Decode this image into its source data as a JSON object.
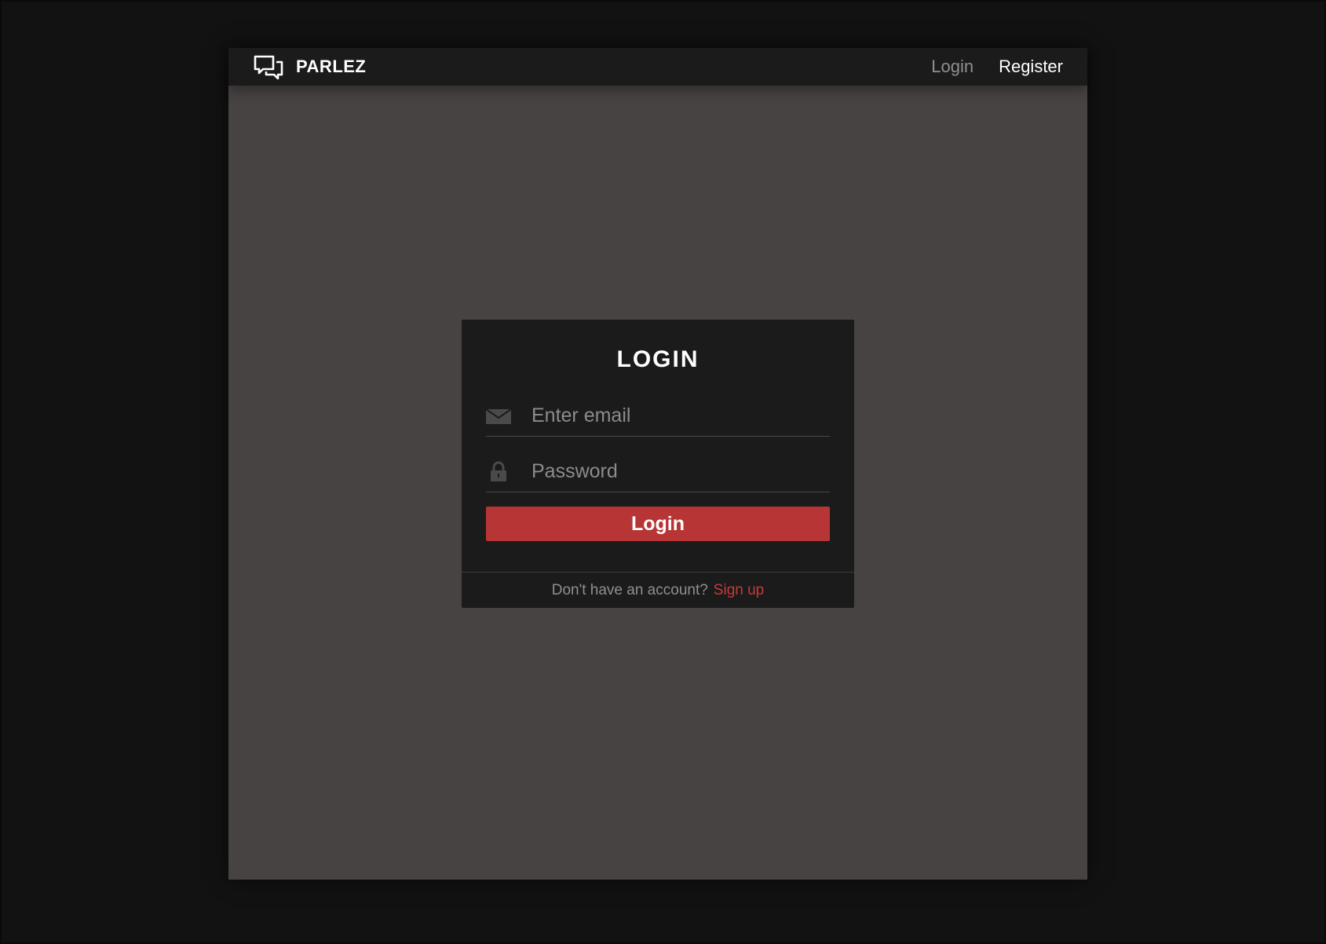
{
  "navbar": {
    "brand_name": "PARLEZ",
    "brand_icon": "chat-bubbles-icon",
    "links": [
      {
        "label": "Login",
        "state": "muted"
      },
      {
        "label": "Register",
        "state": "active"
      }
    ]
  },
  "login_card": {
    "title": "LOGIN",
    "email_field": {
      "icon": "envelope-icon",
      "placeholder": "Enter email",
      "value": ""
    },
    "password_field": {
      "icon": "lock-icon",
      "placeholder": "Password",
      "value": ""
    },
    "submit_label": "Login",
    "footer_text": "Don't have an account?",
    "signup_label": "Sign up"
  },
  "colors": {
    "page_background": "#121212",
    "app_background": "#474343",
    "navbar_background": "#1b1b1b",
    "card_background": "#1b1b1b",
    "accent": "#b83535",
    "signup_link": "#c73a3a",
    "muted_text": "#8f8f8f"
  }
}
